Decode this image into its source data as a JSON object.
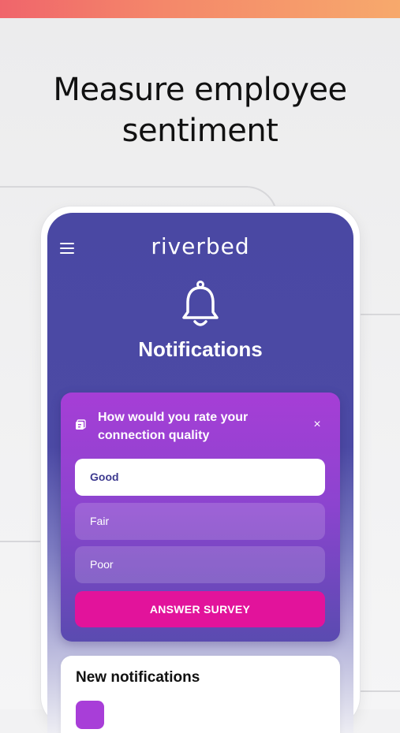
{
  "headline": {
    "line1": "Measure employee",
    "line2": "sentiment"
  },
  "app": {
    "brand": "riverbed",
    "screen_title": "Notifications"
  },
  "survey": {
    "question": "How would you rate your connection quality",
    "options": [
      {
        "label": "Good",
        "selected": true
      },
      {
        "label": "Fair",
        "selected": false
      },
      {
        "label": "Poor",
        "selected": false
      }
    ],
    "answer_label": "ANSWER SURVEY",
    "close_symbol": "×"
  },
  "notifications": {
    "title": "New notifications"
  },
  "icons": {
    "menu": "hamburger-menu-icon",
    "bell": "bell-icon",
    "survey": "survey-icon",
    "close": "close-icon"
  },
  "colors": {
    "accent_pink": "#e2139b",
    "header_purple": "#4a48a3",
    "card_purple": "#a63ed6",
    "top_bar_start": "#f0656b",
    "top_bar_end": "#f7a96c"
  }
}
